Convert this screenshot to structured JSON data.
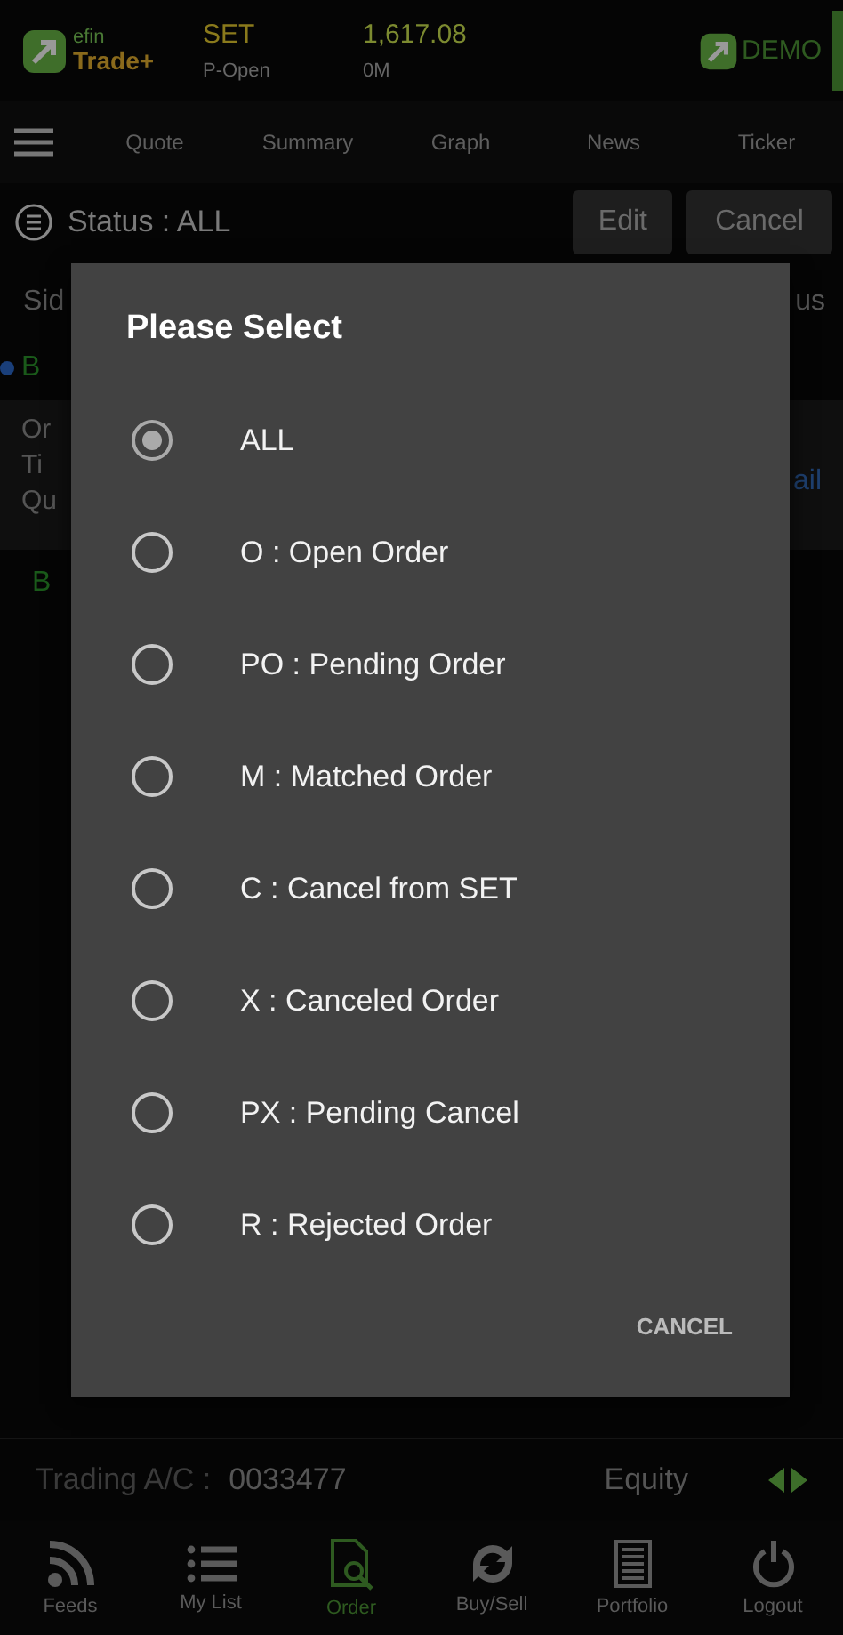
{
  "header": {
    "logo_top": "efin",
    "logo_bottom": "Trade+",
    "market": "SET",
    "market_state": "P-Open",
    "index": "1,617.08",
    "volume": "0M",
    "demo": "DEMO"
  },
  "tabs": [
    {
      "label": "Quote",
      "selected": false
    },
    {
      "label": "Summary",
      "selected": false
    },
    {
      "label": "Graph",
      "selected": false
    },
    {
      "label": "News",
      "selected": false
    },
    {
      "label": "Ticker",
      "selected": false
    }
  ],
  "status_bar": {
    "label": "Status : ALL",
    "buttons": [
      "Edit",
      "Cancel"
    ]
  },
  "background": {
    "column_left": "Sid",
    "column_right": "us",
    "row_side": "B",
    "card_lines": [
      "Or",
      "Ti",
      "Qu"
    ],
    "card_link": "ail",
    "row2_side": "B"
  },
  "dialog": {
    "title": "Please Select",
    "options": [
      {
        "label": "ALL",
        "selected": true
      },
      {
        "label": "O : Open Order",
        "selected": false
      },
      {
        "label": "PO : Pending Order",
        "selected": false
      },
      {
        "label": "M : Matched Order",
        "selected": false
      },
      {
        "label": "C : Cancel from SET",
        "selected": false
      },
      {
        "label": "X : Canceled Order",
        "selected": false
      },
      {
        "label": "PX : Pending Cancel",
        "selected": false
      },
      {
        "label": "R : Rejected Order",
        "selected": false
      }
    ],
    "cancel": "CANCEL"
  },
  "account": {
    "label": "Trading A/C :",
    "number": "0033477",
    "type": "Equity"
  },
  "nav": [
    {
      "kind": "feeds",
      "label": "Feeds",
      "selected": false
    },
    {
      "kind": "list",
      "label": "My List",
      "selected": false
    },
    {
      "kind": "order",
      "label": "Order",
      "selected": true
    },
    {
      "kind": "buysell",
      "label": "Buy/Sell",
      "selected": false
    },
    {
      "kind": "portfolio",
      "label": "Portfolio",
      "selected": false
    },
    {
      "kind": "logout",
      "label": "Logout",
      "selected": false
    }
  ]
}
